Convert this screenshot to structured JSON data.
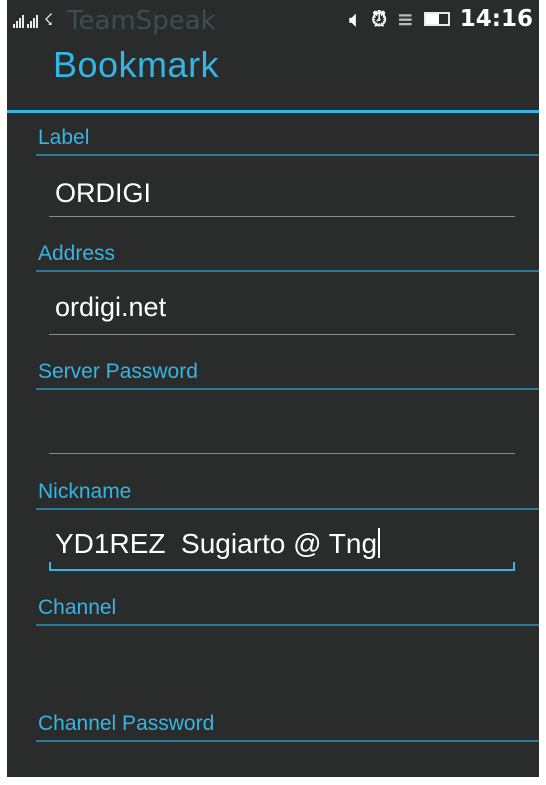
{
  "status_bar": {
    "app_name": "TeamSpeak",
    "time": "14:16",
    "icons": [
      "signal-icon",
      "signal-icon",
      "usb-icon",
      "volume-icon",
      "alarm-icon",
      "wifi-icon",
      "battery-icon"
    ]
  },
  "dialog": {
    "title": "Bookmark",
    "accent_color": "#34b5e5",
    "fields": {
      "label": {
        "caption": "Label",
        "value": "ORDIGI"
      },
      "address": {
        "caption": "Address",
        "value": "ordigi.net"
      },
      "server_password": {
        "caption": "Server Password",
        "value": ""
      },
      "nickname": {
        "caption": "Nickname",
        "value": "YD1REZ  Sugiarto @ Tng"
      },
      "channel": {
        "caption": "Channel",
        "value": ""
      },
      "channel_password": {
        "caption": "Channel Password",
        "value": ""
      }
    }
  }
}
